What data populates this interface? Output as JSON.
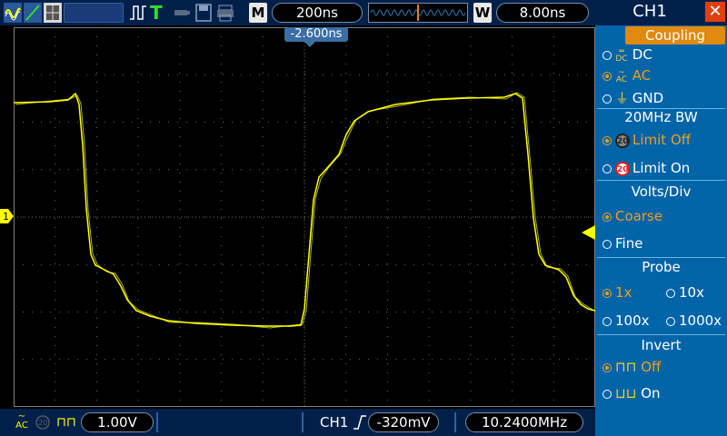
{
  "topbar": {
    "timebase_letter": "M",
    "timebase": "200ns",
    "trigger_letter": "W",
    "window_time": "8.00ns",
    "trigger_status": "T"
  },
  "screen": {
    "trigger_position": "-2.600ns",
    "channel_marker": "1",
    "trace_color": "#ffff00",
    "grid_color": "#6e6e6e"
  },
  "bottombar": {
    "volts_per_div": "1.00V",
    "trigger_channel": "CH1",
    "trigger_level": "-320mV",
    "frequency": "10.2400MHz"
  },
  "panel": {
    "title": "CH1",
    "coupling": {
      "header": "Coupling",
      "options": [
        {
          "label": "DC",
          "selected": false
        },
        {
          "label": "AC",
          "selected": true
        },
        {
          "label": "GND",
          "selected": false
        }
      ]
    },
    "bandwidth": {
      "header": "20MHz BW",
      "options": [
        {
          "label": "Limit Off",
          "selected": true
        },
        {
          "label": "Limit On",
          "selected": false
        }
      ]
    },
    "volts_div": {
      "header": "Volts/Div",
      "options": [
        {
          "label": "Coarse",
          "selected": true
        },
        {
          "label": "Fine",
          "selected": false
        }
      ]
    },
    "probe": {
      "header": "Probe",
      "options": [
        {
          "label": "1x",
          "selected": true
        },
        {
          "label": "10x",
          "selected": false
        },
        {
          "label": "100x",
          "selected": false
        },
        {
          "label": "1000x",
          "selected": false
        }
      ]
    },
    "invert": {
      "header": "Invert",
      "options": [
        {
          "label": "Off",
          "selected": true
        },
        {
          "label": "On",
          "selected": false
        }
      ]
    }
  },
  "badge_text": "20",
  "coupling_icons": {
    "dc": "DC",
    "ac": "AC"
  },
  "colors": {
    "panel_bg": "#0064a8",
    "bar_bg": "#00204a",
    "accent_orange": "#e08a10",
    "selected_text": "#f0a020",
    "close_red": "#e04010"
  }
}
